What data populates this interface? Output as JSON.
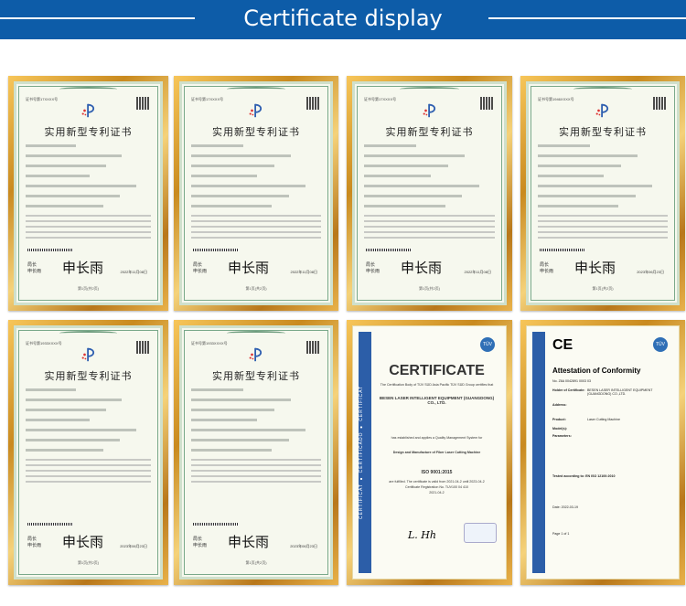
{
  "header": {
    "title": "Certificate display",
    "color": "#0d5ca8"
  },
  "patents": [
    {
      "title": "实用新型专利证书",
      "no": "证书号第17XXXX号",
      "signer": "申长雨",
      "sign_label": "局长",
      "date": "2022年11月08日",
      "footer": "第1页(共2页)"
    },
    {
      "title": "实用新型专利证书",
      "no": "证书号第17XXXX号",
      "signer": "申长雨",
      "sign_label": "局长",
      "date": "2022年11月08日",
      "footer": "第1页(共2页)"
    },
    {
      "title": "实用新型专利证书",
      "no": "证书号第17XXXX号",
      "signer": "申长雨",
      "sign_label": "局长",
      "date": "2022年11月08日",
      "footer": "第1页(共2页)"
    },
    {
      "title": "实用新型专利证书",
      "no": "证书号第1946XXXX号",
      "signer": "申长雨",
      "sign_label": "局长",
      "date": "2023年06月23日",
      "footer": "第1页(共2页)"
    },
    {
      "title": "实用新型专利证书",
      "no": "证书号第1933XXXX号",
      "signer": "申长雨",
      "sign_label": "局长",
      "date": "2023年06月23日",
      "footer": "第1页(共2页)"
    },
    {
      "title": "实用新型专利证书",
      "no": "证书号第1933XXXX号",
      "signer": "申长雨",
      "sign_label": "局长",
      "date": "2023年06月23日",
      "footer": "第1页(共2页)"
    }
  ],
  "iso": {
    "side": "CERTIFICAT ● CERTIFICADO ● CERTIFICAT",
    "title": "CERTIFICATE",
    "body": "The Certification Body of TÜV SÜD Asia Pacific TÜV SÜD Group certifies that",
    "company": "BESEN LASER INTELLIGENT EQUIPMENT (GUANGDONG) CO., LTD.",
    "applied": "has established and applies a Quality Management System for",
    "scope": "Design and Manufacture of Fiber Laser Cutting Machine",
    "standard": "ISO 9001:2015",
    "valid": "are fulfilled. The certificate is valid from 2021-04-2 until 2023-04-2",
    "reg": "Certificate Registration No. TUV100 04 410",
    "date": "2021-04-2",
    "mark": "TÜV"
  },
  "ce": {
    "logo": "CE",
    "title": "Attestation of Conformity",
    "no": "No. Z6A 0042891 0003 03",
    "holder_label": "Holder of Certificate:",
    "holder": "BESEN LASER INTELLIGENT EQUIPMENT (GUANGDONG) CO.,LTD.",
    "address_label": "Address:",
    "product_label": "Product:",
    "product": "Laser Cutting Machine",
    "model_label": "Model(s):",
    "params_label": "Parameters:",
    "tested": "Tested according to: EN ISO 12100:2010",
    "date": "Date: 2022-03-19",
    "page": "Page 1 of 1",
    "mark": "TÜV"
  }
}
